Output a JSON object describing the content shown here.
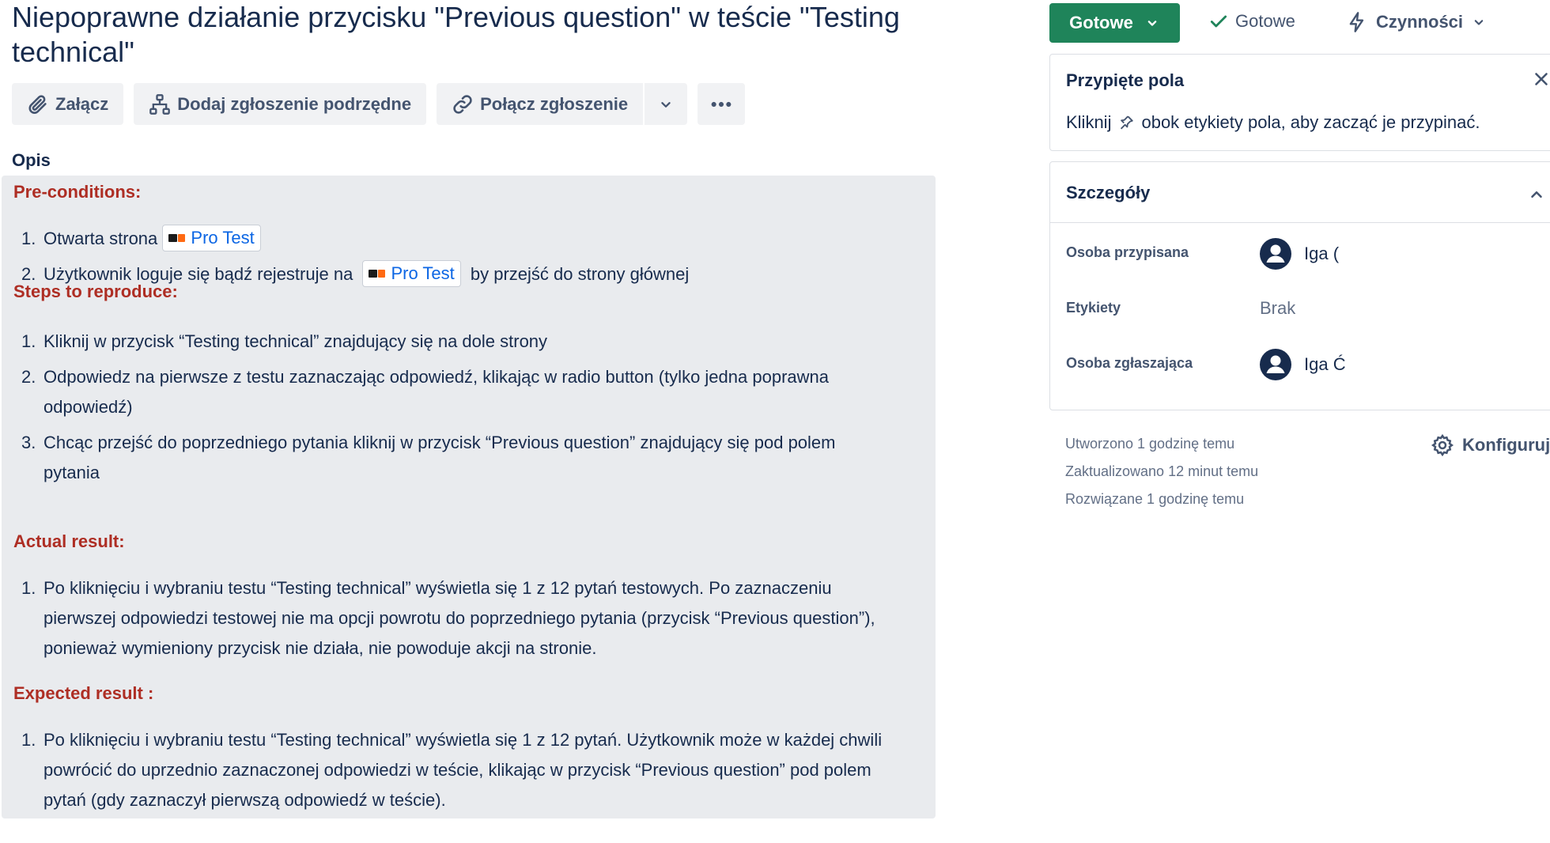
{
  "issue": {
    "title": "Niepoprawne działanie przycisku \"Previous question\" w teście \"Testing technical\""
  },
  "toolbar": {
    "attach_label": "Załącz",
    "add_child_label": "Dodaj zgłoszenie podrzędne",
    "link_issue_label": "Połącz zgłoszenie"
  },
  "description": {
    "label": "Opis",
    "preconditions": {
      "heading": "Pre-conditions:",
      "item1_num": "1.",
      "item1_text": "Otwarta strona",
      "item2_num": "2.",
      "item2_before": "Użytkownik loguje się bądź rejestruje na",
      "item2_after": "by przejść do strony głównej",
      "link_label": "Pro Test"
    },
    "steps": {
      "heading": "Steps to reproduce:",
      "items": [
        {
          "num": "1.",
          "line1": "Kliknij w przycisk “Testing technical” znajdujący się na dole strony",
          "line2": ""
        },
        {
          "num": "2.",
          "line1": "Odpowiedz na pierwsze z testu zaznaczając odpowiedź, klikając w radio button (tylko jedna poprawna",
          "line2": "odpowiedź)"
        },
        {
          "num": "3.",
          "line1": "Chcąc przejść do poprzedniego pytania kliknij w przycisk “Previous question” znajdujący się pod polem",
          "line2": "pytania"
        }
      ]
    },
    "actual": {
      "heading": "Actual result:",
      "num": "1.",
      "line1": "Po kliknięciu i wybraniu testu “Testing technical” wyświetla się 1 z 12 pytań testowych. Po zaznaczeniu",
      "line2": "pierwszej odpowiedzi testowej nie ma opcji powrotu do poprzedniego pytania (przycisk “Previous question”),",
      "line3": "ponieważ wymieniony przycisk nie działa, nie powoduje akcji na stronie."
    },
    "expected": {
      "heading": "Expected result :",
      "num": "1.",
      "line1": "Po kliknięciu i wybraniu testu “Testing technical” wyświetla się 1 z 12 pytań. Użytkownik może w każdej chwili",
      "line2": "powrócić do uprzednio zaznaczonej odpowiedzi w teście, klikając w przycisk “Previous question” pod polem",
      "line3": "pytań (gdy zaznaczył pierwszą odpowiedź w teście)."
    }
  },
  "sidebar": {
    "status_button_label": "Gotowe",
    "status_indicator_label": "Gotowe",
    "actions_label": "Czynności",
    "pinned": {
      "title": "Przypięte pola",
      "text_before": "Kliknij",
      "text_after": "obok etykiety pola, aby zacząć je przypinać."
    },
    "details": {
      "title": "Szczegóły",
      "assignee_label": "Osoba przypisana",
      "assignee_value": "Iga (",
      "labels_label": "Etykiety",
      "labels_value": "Brak",
      "reporter_label": "Osoba zgłaszająca",
      "reporter_value": "Iga Ć"
    },
    "meta": {
      "created": "Utworzono 1 godzinę temu",
      "updated": "Zaktualizowano 12 minut temu",
      "resolved": "Rozwiązane 1 godzinę temu"
    },
    "configure_label": "Konfiguruj"
  },
  "colors": {
    "status_green": "#1f845a",
    "heading_red": "#ae2e24",
    "link_blue": "#0c66e4"
  }
}
